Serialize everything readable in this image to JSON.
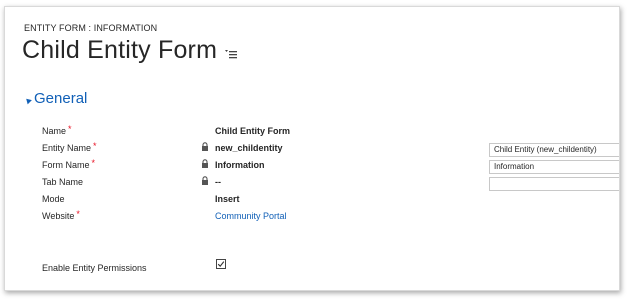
{
  "header": {
    "breadcrumb": "ENTITY FORM : INFORMATION",
    "title": "Child Entity Form"
  },
  "section": {
    "title": "General"
  },
  "fields": {
    "name": {
      "label": "Name",
      "required": "*",
      "value": "Child Entity Form"
    },
    "entity_name": {
      "label": "Entity Name",
      "required": "*",
      "value": "new_childentity",
      "dropdown_value": "Child Entity (new_childentity)"
    },
    "form_name": {
      "label": "Form Name",
      "required": "*",
      "value": "Information",
      "dropdown_value": "Information"
    },
    "tab_name": {
      "label": "Tab Name",
      "value": "--",
      "dropdown_value": ""
    },
    "mode": {
      "label": "Mode",
      "value": "Insert"
    },
    "website": {
      "label": "Website",
      "required": "*",
      "value": "Community Portal"
    },
    "enable_permissions": {
      "label": "Enable Entity Permissions",
      "checked": true
    }
  },
  "icons": {
    "form_menu": "form-menu-icon",
    "lock": "lock-icon",
    "collapse": "collapse-arrow-icon",
    "checkmark": "checkmark-icon"
  },
  "colors": {
    "accent": "#1160b7",
    "required": "#e81123",
    "text": "#262626"
  }
}
